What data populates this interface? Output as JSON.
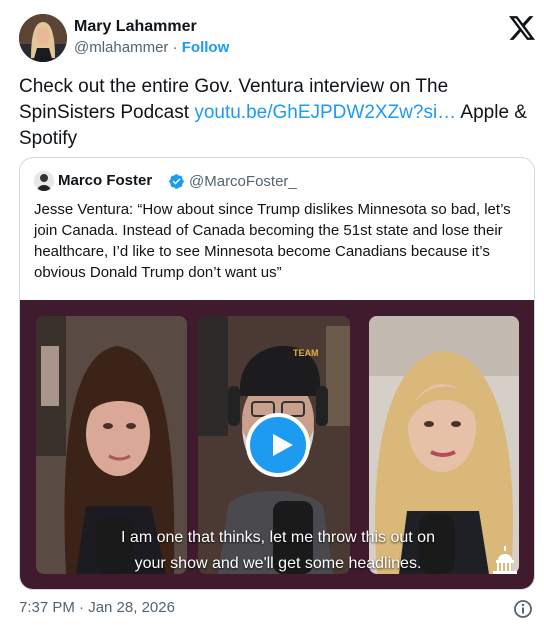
{
  "author": {
    "display_name": "Mary Lahammer",
    "handle": "@mlahammer",
    "separator": "·",
    "follow_label": "Follow",
    "avatar_icon": "profile-photo"
  },
  "brand": {
    "logo_icon": "x-logo"
  },
  "tweet": {
    "text_before_link": "Check out the entire Gov. Ventura interview on The SpinSisters Podcast ",
    "link_text": "youtu.be/GhEJPDW2XZw?si…",
    "text_after_link": "  Apple & Spotify"
  },
  "quote": {
    "display_name": "Marco Foster",
    "handle": "@MarcoFoster_",
    "verified_icon": "verified-badge-icon",
    "text": "Jesse Ventura: “How about since Trump dislikes Minnesota so bad, let’s join Canada. Instead of Canada becoming the 51st state and lose their healthcare, I’d like to see Minnesota become Canadians because it’s obvious Donald Trump don’t want us”",
    "media": {
      "caption_line1": "I am one that thinks, let me throw this out on",
      "caption_line2": "your show and we'll get some headlines.",
      "play_icon": "play-icon",
      "hat_text": "TEAM"
    }
  },
  "footer": {
    "timestamp": "7:37 PM · Jan 28, 2026",
    "info_icon": "info-icon"
  },
  "colors": {
    "link_blue": "#1d9bf0",
    "text_primary": "#0f1419",
    "text_secondary": "#536471",
    "border": "#cfd9de",
    "media_bg": "#3f1b2d"
  }
}
